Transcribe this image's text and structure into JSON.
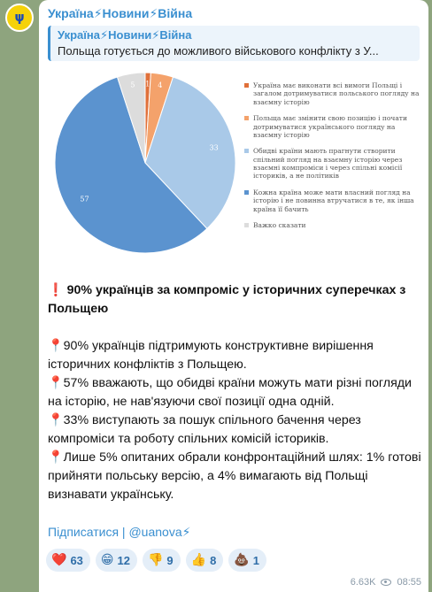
{
  "channel": {
    "name": "Україна⚡Новини⚡Війна",
    "avatar_icon": "trident-icon"
  },
  "reply": {
    "title": "Україна⚡Новини⚡Війна",
    "text": "Польща готується до можливого військового конфлікту з У..."
  },
  "chart_data": {
    "type": "pie",
    "slices": [
      {
        "label": "Україна має виконати всі вимоги Польщі і загалом дотримуватися польського погляду на взаємну історію",
        "value": 1,
        "color": "#e0703a"
      },
      {
        "label": "Польща має змінити свою позицію і почати дотримуватися українського погляду на взаємну історію",
        "value": 4,
        "color": "#f4a26b"
      },
      {
        "label": "Обидві країни мають прагнути створити спільний погляд на взаємну історію через взаємні компроміси і через спільні комісії істориків, а не політиків",
        "value": 33,
        "color": "#a9c9e8"
      },
      {
        "label": "Кожна країна може мати власний погляд на історію і не повинна втручатися в те, як інша країна її бачить",
        "value": 57,
        "color": "#5b93cf"
      },
      {
        "label": "Важко сказати",
        "value": 5,
        "color": "#dcdcdc"
      }
    ]
  },
  "post": {
    "headline": "❗️ 90% українців за компроміс у історичних суперечках з Польщею",
    "lines": [
      "📍90% українців підтримують конструктивне вирішення історичних конфліктів з Польщею.",
      "📍57% вважають, що обидві країни можуть мати різні погляди на історію, не нав'язуючи свої позиції одна одній.",
      "📍33% виступають за пошук спільного бачення через компроміси та роботу спільних комісій істориків.",
      "📍Лише 5% опитаних обрали конфронтаційний шлях: 1% готові прийняти польську версію, а 4% вимагають від Польщі визнавати українську."
    ]
  },
  "links": {
    "subscribe": "Підписатися",
    "separator": " | ",
    "handle": "@uanova⚡"
  },
  "reactions": [
    {
      "emoji": "❤️",
      "count": "63",
      "icon": "heart-icon"
    },
    {
      "emoji": "😁",
      "count": "12",
      "icon": "grin-icon"
    },
    {
      "emoji": "👎",
      "count": "9",
      "icon": "thumbs-down-icon"
    },
    {
      "emoji": "👍",
      "count": "8",
      "icon": "thumbs-up-icon"
    },
    {
      "emoji": "💩",
      "count": "1",
      "icon": "poop-icon"
    }
  ],
  "meta": {
    "views": "6.63K",
    "time": "08:55"
  }
}
